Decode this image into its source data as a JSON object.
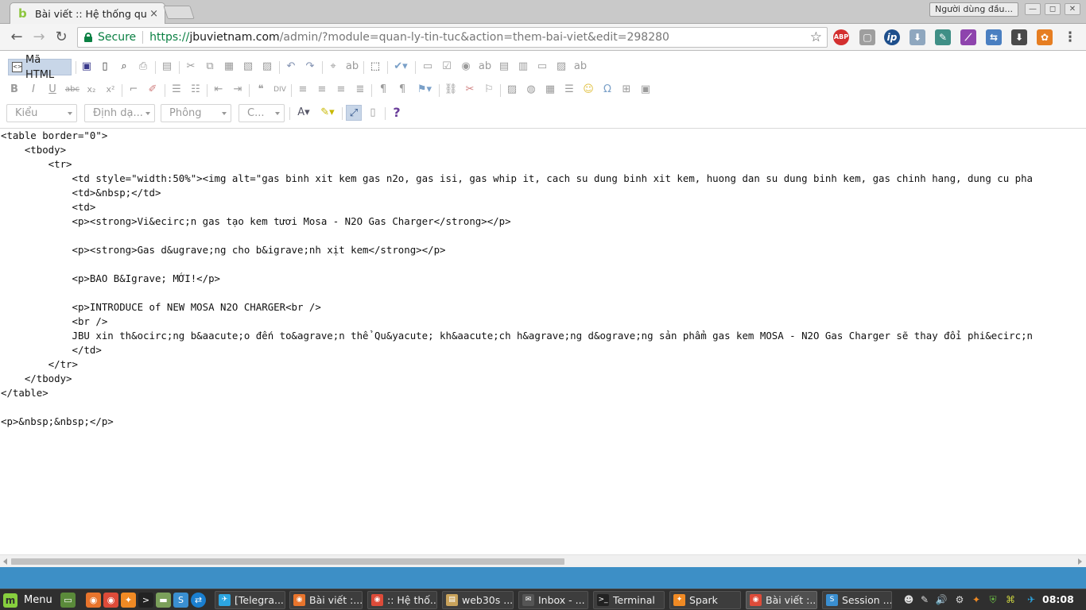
{
  "browser": {
    "tab_title": "Bài viết :: Hệ thống quản",
    "tab_close": "×",
    "profile_label": "Người dùng đầu...",
    "window_controls": [
      "—",
      "◻",
      "✕"
    ]
  },
  "omnibox": {
    "secure_label": "Secure",
    "url_scheme": "https://",
    "url_host": "jbuvietnam.com",
    "url_path": "/admin/?module=quan-ly-tin-tuc&action=them-bai-viet&edit=298280"
  },
  "extensions": [
    {
      "name": "adblock-plus-icon",
      "glyph": "ABP",
      "color": "#d32f2f"
    },
    {
      "name": "page-extension-icon",
      "glyph": "▢",
      "color": "#9e9e9e"
    },
    {
      "name": "ip-icon",
      "glyph": "ip",
      "color": "#1e4f8c"
    },
    {
      "name": "download-arrow-icon",
      "glyph": "⬇",
      "color": "#8fa7bf"
    },
    {
      "name": "eyedropper-icon",
      "glyph": "✎",
      "color": "#3f8f86"
    },
    {
      "name": "feather-icon",
      "glyph": "⟋",
      "color": "#8e44ad"
    },
    {
      "name": "translate-icon",
      "glyph": "⇆",
      "color": "#4a7fc1"
    },
    {
      "name": "save-down-icon",
      "glyph": "⬇",
      "color": "#4a4a4a"
    },
    {
      "name": "colorful-extension-icon",
      "glyph": "✿",
      "color": "#e67e22"
    },
    {
      "name": "chrome-menu-icon",
      "glyph": "⋮",
      "color": "#f4f4f4"
    }
  ],
  "editor": {
    "source_button_label": "Mã HTML",
    "combos": {
      "style": "Kiểu",
      "format": "Định dạ...",
      "font": "Phông",
      "size": "C..."
    },
    "help_glyph": "?",
    "source_text": "<table border=\"0\">\n    <tbody>\n        <tr>\n            <td style=\"width:50%\"><img alt=\"gas binh xit kem gas n2o, gas isi, gas whip it, cach su dung binh xit kem, huong dan su dung binh kem, gas chinh hang, dung cu pha\n            <td>&nbsp;</td>\n            <td>\n            <p><strong>Vi&ecirc;n gas tạo kem tươi Mosa - N2O Gas Charger</strong></p>\n\n            <p><strong>Gas d&ugrave;ng cho b&igrave;nh xịt kem</strong></p>\n\n            <p>BAO B&Igrave; MỚI!</p>\n\n            <p>INTRODUCE of NEW MOSA N2O CHARGER<br />\n            <br />\n            JBU xin th&ocirc;ng b&aacute;o đến to&agrave;n thể Qu&yacute; kh&aacute;ch h&agrave;ng d&ograve;ng sản phẩm gas kem MOSA - N2O Gas Charger sẽ thay đổi phi&ecirc;n\n            </td>\n        </tr>\n    </tbody>\n</table>\n\n<p>&nbsp;&nbsp;</p>"
  },
  "taskbar": {
    "menu_label": "Menu",
    "tasks": [
      {
        "label": "[Telegra...",
        "icon_color": "#2ca5e0",
        "glyph": "✈"
      },
      {
        "label": "Bài viết :...",
        "icon_color": "#e8742c",
        "glyph": "◉"
      },
      {
        "label": ":: Hệ thố...",
        "icon_color": "#dd4b39",
        "glyph": "◉"
      },
      {
        "label": "web30s ...",
        "icon_color": "#c9a35b",
        "glyph": "▤"
      },
      {
        "label": "Inbox - ...",
        "icon_color": "#555555",
        "glyph": "✉"
      },
      {
        "label": "Terminal",
        "icon_color": "#222222",
        "glyph": ">_"
      },
      {
        "label": "Spark",
        "icon_color": "#f08a24",
        "glyph": "✦"
      },
      {
        "label": "Bài viết :...",
        "icon_color": "#dd4b39",
        "glyph": "◉"
      },
      {
        "label": "Session ...",
        "icon_color": "#3a8fd1",
        "glyph": "S"
      }
    ],
    "clock": "08:08"
  }
}
